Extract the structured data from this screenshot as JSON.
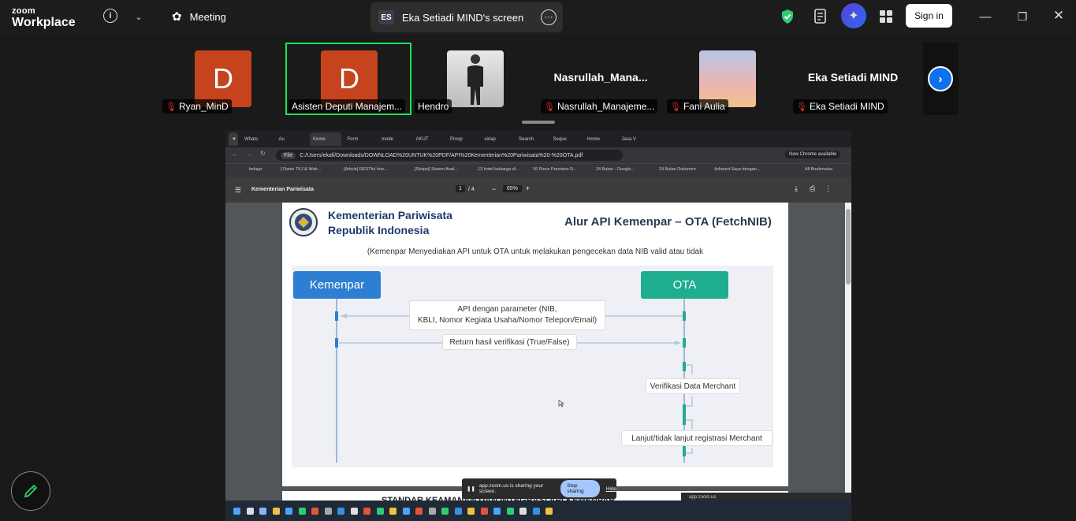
{
  "app": {
    "brand_line1": "zoom",
    "brand_line2": "Workplace"
  },
  "topbar": {
    "meeting_label": "Meeting",
    "share_badge": "ES",
    "share_title": "Eka Setiadi MIND's screen",
    "signin_label": "Sign in"
  },
  "participants": [
    {
      "name": "Ryan_MinD",
      "initial": "D",
      "muted": true
    },
    {
      "name": "Asisten Deputi Manajem...",
      "initial": "D",
      "muted": false,
      "active": true
    },
    {
      "name": "Hendro",
      "initial": "",
      "muted": false
    },
    {
      "name": "Nasrullah_Manajeme...",
      "display": "Nasrullah_Mana...",
      "muted": true
    },
    {
      "name": "Fani Aulia",
      "muted": true
    },
    {
      "name": "Eka Setiadi MIND",
      "display": "Eka Setiadi MIND",
      "muted": true
    }
  ],
  "browser": {
    "tabs": [
      "Whats",
      "Au",
      "Keme",
      "Form",
      "mode",
      "AKUT",
      "Prosp",
      "siriap",
      "Search",
      "Seque",
      "Home",
      "Jasa V"
    ],
    "address": "C:/Users/ekafi/Downloads/DOWNLOAD%20UNTUK%20PDF/API%20Kementerian%20Pariwisata%20-%20OTA.pdf",
    "file_label": "File",
    "update_label": "New Chrome available",
    "bookmarks": [
      "belajar",
      "[ Danie TKJ & Web...",
      "[Article] RESTful Inte...",
      "[Skripsi] Sistem Anal...",
      "13 hotel keluarga di...",
      "16 Piece Precision R...",
      "24 Bulan - Google...",
      "24 Bulan Dokumen",
      "4shared Saya dengan...",
      "All Bookmarks"
    ]
  },
  "pdf": {
    "doc_title": "Kementerian Pariwisata",
    "page_current": "1",
    "page_total": "/ 4",
    "zoom": "65%"
  },
  "slide": {
    "org_line1": "Kementerian Pariwisata",
    "org_line2": "Republik Indonesia",
    "title": "Alur API Kemenpar – OTA (FetchNIB)",
    "subtitle": "(Kemenpar Menyediakan API untuk OTA untuk melakukan pengecekan data NIB valid atau tidak",
    "lane_left": "Kemenpar",
    "lane_right": "OTA",
    "msg1_line1": "API dengan parameter (NIB,",
    "msg1_line2": "KBLI, Nomor Kegiata Usaha/Nomor Telepon/Email)",
    "msg2": "Return hasil verifikasi (True/False)",
    "msg3": "Verifikasi Data Merchant",
    "msg4": "Lanjut/tidak lanjut registrasi Merchant",
    "next_heading": "STANDAR KEAMANAN DAN INTEGRASI API KEMENPAR"
  },
  "share_bar": {
    "text": "app.zoom.us is sharing your screen.",
    "stop": "Stop sharing",
    "hide": "Hide"
  },
  "tooltip": "app.zoom.us",
  "colors": {
    "kemenpar": "#2d7fd3",
    "ota": "#1fad8f",
    "accent": "#0e71eb",
    "active_border": "#21e05b"
  }
}
